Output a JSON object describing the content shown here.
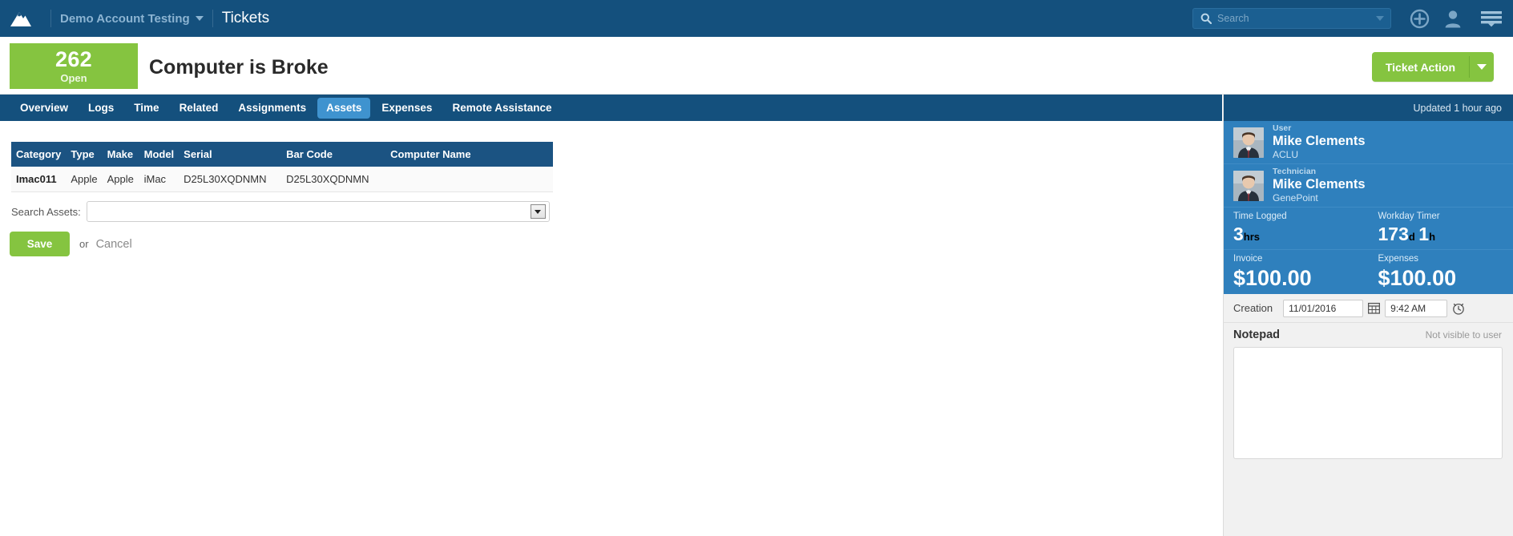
{
  "topnav": {
    "logo": "mountain-logo",
    "account_name": "Demo Account Testing",
    "section_title": "Tickets",
    "search_placeholder": "Search",
    "search_value": "",
    "add_icon": "plus-circle-icon",
    "user_icon": "person-icon",
    "menu_icon": "hamburger-menu-icon"
  },
  "titlebar": {
    "badge_count": "262",
    "badge_status": "Open",
    "badge_color": "#85c440",
    "ticket_title": "Computer is Broke",
    "action_label": "Ticket Action"
  },
  "tabs": [
    {
      "label": "Overview",
      "active": false
    },
    {
      "label": "Logs",
      "active": false
    },
    {
      "label": "Time",
      "active": false
    },
    {
      "label": "Related",
      "active": false
    },
    {
      "label": "Assignments",
      "active": false
    },
    {
      "label": "Assets",
      "active": true
    },
    {
      "label": "Expenses",
      "active": false
    },
    {
      "label": "Remote Assistance",
      "active": false
    }
  ],
  "assets": {
    "columns": [
      "Category",
      "Type",
      "Make",
      "Model",
      "Serial",
      "Bar Code",
      "Computer Name"
    ],
    "rows": [
      {
        "category": "Imac011",
        "type": "Apple",
        "make": "Apple",
        "model": "iMac",
        "serial": "D25L30XQDNMN",
        "bar_code": "D25L30XQDNMN",
        "computer_name": ""
      }
    ],
    "search_label": "Search Assets:",
    "search_value": "",
    "search_placeholder": "",
    "save_label": "Save",
    "or_label": "or",
    "cancel_label": "Cancel"
  },
  "sidebar": {
    "updated_text": "Updated 1 hour ago",
    "people": [
      {
        "role": "User",
        "name": "Mike Clements",
        "org": "ACLU"
      },
      {
        "role": "Technician",
        "name": "Mike Clements",
        "org": "GenePoint"
      }
    ],
    "stats": [
      {
        "label": "Time Logged",
        "value": "3",
        "unit": "hrs"
      },
      {
        "label": "Workday Timer",
        "value": "173",
        "unit": "d",
        "value2": "1",
        "unit2": "h"
      }
    ],
    "money": [
      {
        "label": "Invoice",
        "value": "$100.00"
      },
      {
        "label": "Expenses",
        "value": "$100.00"
      }
    ],
    "creation": {
      "label": "Creation",
      "date": "11/01/2016",
      "time": "9:42 AM",
      "calendar_icon": "calendar-icon",
      "clock_icon": "clock-icon"
    },
    "notepad": {
      "title": "Notepad",
      "visibility": "Not visible to user",
      "value": "",
      "placeholder": ""
    }
  }
}
